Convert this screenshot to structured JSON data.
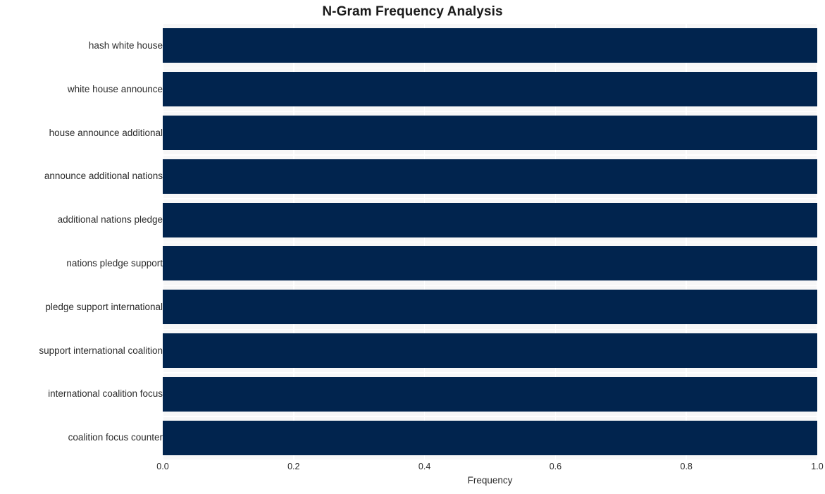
{
  "chart_data": {
    "type": "bar",
    "orientation": "horizontal",
    "title": "N-Gram Frequency Analysis",
    "xlabel": "Frequency",
    "ylabel": "",
    "categories": [
      "hash white house",
      "white house announce",
      "house announce additional",
      "announce additional nations",
      "additional nations pledge",
      "nations pledge support",
      "pledge support international",
      "support international coalition",
      "international coalition focus",
      "coalition focus counter"
    ],
    "values": [
      1.0,
      1.0,
      1.0,
      1.0,
      1.0,
      1.0,
      1.0,
      1.0,
      1.0,
      1.0
    ],
    "xlim": [
      0.0,
      1.0
    ],
    "xticks": [
      0.0,
      0.2,
      0.4,
      0.6,
      0.8,
      1.0
    ],
    "xtick_labels": [
      "0.0",
      "0.2",
      "0.4",
      "0.6",
      "0.8",
      "1.0"
    ],
    "grid": true,
    "legend": null,
    "bar_color": "#01244e",
    "plot_background": "#f7f7f7",
    "grid_color": "#ffffff",
    "figure_background": "#ffffff"
  }
}
